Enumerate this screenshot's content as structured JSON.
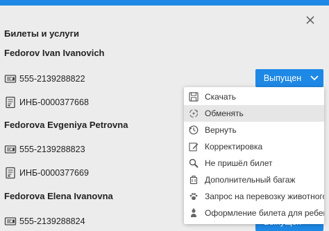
{
  "dialog": {
    "title": "Билеты и услуги"
  },
  "passengers": [
    {
      "name": "Fedorov Ivan Ivanovich",
      "ticket": "555-2139288822",
      "service": "ИНБ-0000377668",
      "status_label": "Выпущен"
    },
    {
      "name": "Fedorova Evgeniya Petrovna",
      "ticket": "555-2139288823",
      "service": "ИНБ-0000377669"
    },
    {
      "name": "Fedorova Elena Ivanovna",
      "ticket": "555-2139288824",
      "status_label": "Выпущен"
    }
  ],
  "menu": {
    "items": [
      {
        "label": "Скачать",
        "icon": "save-icon"
      },
      {
        "label": "Обменять",
        "icon": "exchange-icon",
        "highlighted": true
      },
      {
        "label": "Вернуть",
        "icon": "return-icon"
      },
      {
        "label": "Корректировка",
        "icon": "edit-icon"
      },
      {
        "label": "Не пришёл билет",
        "icon": "search-icon"
      },
      {
        "label": "Дополнительный багаж",
        "icon": "luggage-icon"
      },
      {
        "label": "Запрос на перевозку животного",
        "icon": "paw-icon"
      },
      {
        "label": "Оформление билета для ребенка",
        "icon": "child-icon"
      }
    ]
  },
  "colors": {
    "accent": "#1e88e5",
    "background": "#ececec",
    "menu_highlight": "#e6e6e6"
  }
}
